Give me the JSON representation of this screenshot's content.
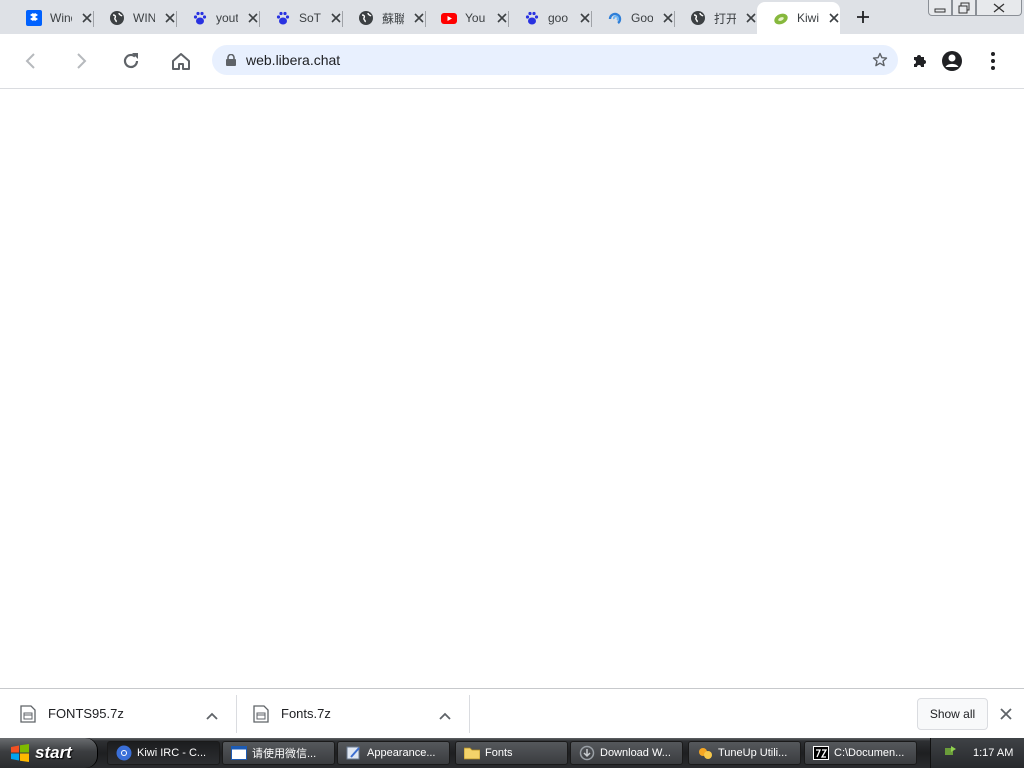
{
  "tabs": [
    {
      "title": "Wind",
      "icon": "dropbox-icon"
    },
    {
      "title": "WIN",
      "icon": "globe-icon"
    },
    {
      "title": "yout",
      "icon": "baidu-paw-icon"
    },
    {
      "title": "SoTu",
      "icon": "baidu-paw-icon"
    },
    {
      "title": "蘇聯",
      "icon": "globe-icon"
    },
    {
      "title": "You",
      "icon": "youtube-icon"
    },
    {
      "title": "goo",
      "icon": "baidu-paw-icon"
    },
    {
      "title": "Goo",
      "icon": "spiral-icon"
    },
    {
      "title": "打开",
      "icon": "globe-icon"
    },
    {
      "title": "Kiwi",
      "icon": "kiwi-icon",
      "active": true
    }
  ],
  "address_bar": {
    "url": "web.libera.chat"
  },
  "downloads": [
    {
      "name": "FONTS95.7z"
    },
    {
      "name": "Fonts.7z"
    }
  ],
  "shelf": {
    "show_all_label": "Show all"
  },
  "taskbar": {
    "start_label": "start",
    "tasks": [
      {
        "label": "Kiwi IRC - C...",
        "icon": "chrome-icon",
        "active": true
      },
      {
        "label": "请使用微信...",
        "icon": "window-icon"
      },
      {
        "label": "Appearance...",
        "icon": "appearance-icon"
      },
      {
        "label": "Fonts",
        "icon": "folder-icon"
      },
      {
        "label": "Download W...",
        "icon": "download-icon"
      },
      {
        "label": "TuneUp Utili...",
        "icon": "tuneup-icon"
      },
      {
        "label": "C:\\Documen...",
        "icon": "7zip-icon"
      }
    ],
    "clock": "1:17 AM"
  },
  "colors": {
    "tabstrip": "#dee1e6",
    "omnibox": "#e8f0fe",
    "taskbar": "#1e1f21"
  }
}
